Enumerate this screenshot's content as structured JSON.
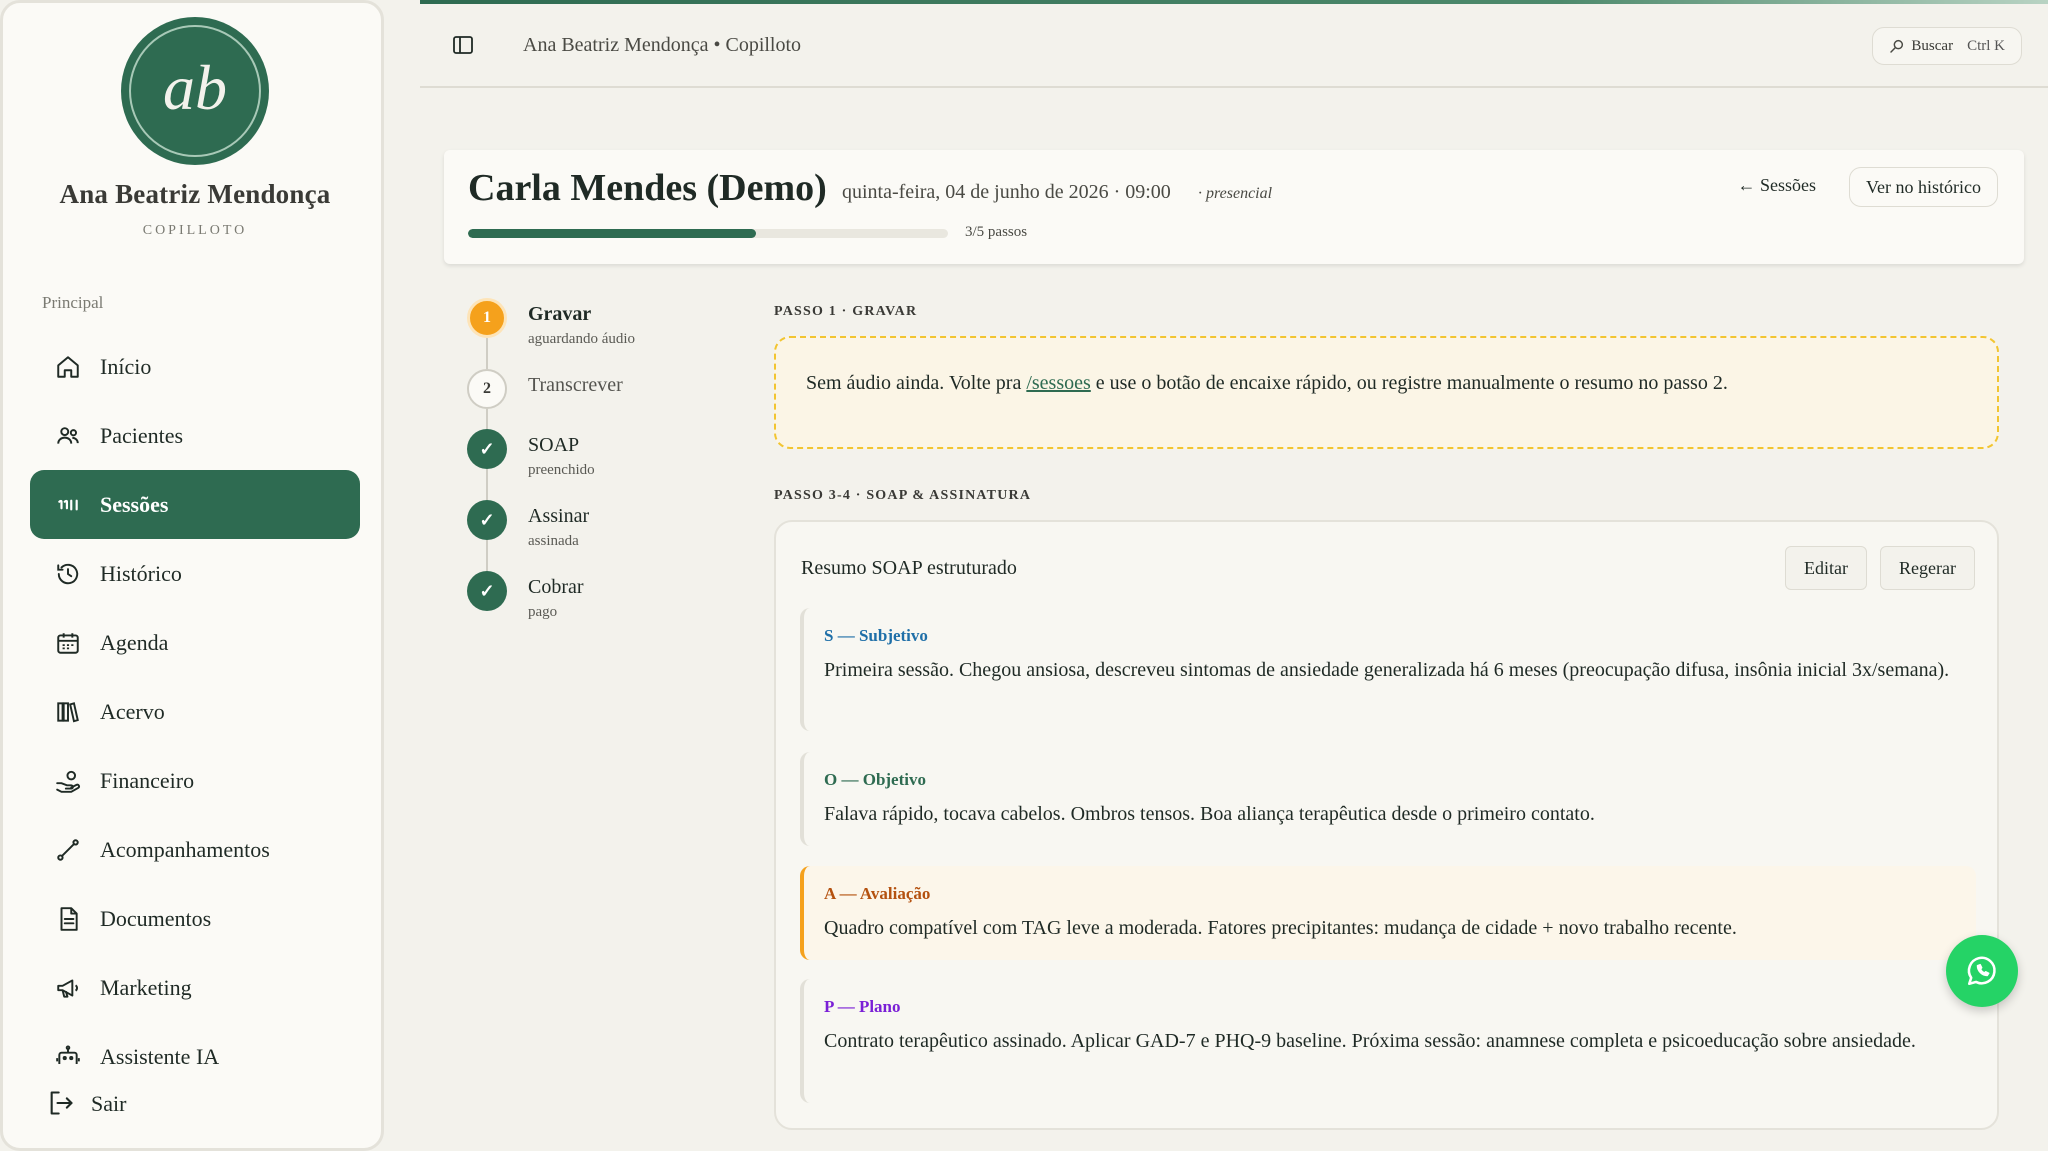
{
  "sidebar": {
    "avatar_initials": "ab",
    "brand_name": "Ana Beatriz Mendonça",
    "brand_sub": "COPILLOTO",
    "section_label": "Principal",
    "items": [
      {
        "label": "Início",
        "icon": "home-icon"
      },
      {
        "label": "Pacientes",
        "icon": "users-icon"
      },
      {
        "label": "Sessões",
        "icon": "sessions-icon",
        "active": true
      },
      {
        "label": "Histórico",
        "icon": "history-icon"
      },
      {
        "label": "Agenda",
        "icon": "calendar-icon"
      },
      {
        "label": "Acervo",
        "icon": "library-icon"
      },
      {
        "label": "Financeiro",
        "icon": "finance-icon"
      },
      {
        "label": "Acompanhamentos",
        "icon": "route-icon"
      },
      {
        "label": "Documentos",
        "icon": "document-icon"
      },
      {
        "label": "Marketing",
        "icon": "megaphone-icon"
      },
      {
        "label": "Assistente IA",
        "icon": "bot-icon"
      }
    ],
    "logout_label": "Sair"
  },
  "topbar": {
    "breadcrumb": "Ana Beatriz Mendonça • Copilloto",
    "search_label": "Buscar",
    "search_shortcut": "Ctrl K"
  },
  "session": {
    "patient_name": "Carla Mendes (Demo)",
    "date_time": "quinta-feira, 04 de junho de 2026 · 09:00",
    "mode": "· presencial",
    "progress_label": "3/5 passos",
    "progress_fraction": 0.6,
    "back_link": "← Sessões",
    "history_button": "Ver no histórico"
  },
  "steps": [
    {
      "number": "1",
      "title": "Gravar",
      "sub": "aguardando áudio",
      "state": "current"
    },
    {
      "number": "2",
      "title": "Transcrever",
      "sub": "",
      "state": "pending"
    },
    {
      "number": "✓",
      "title": "SOAP",
      "sub": "preenchido",
      "state": "done"
    },
    {
      "number": "✓",
      "title": "Assinar",
      "sub": "assinada",
      "state": "done"
    },
    {
      "number": "✓",
      "title": "Cobrar",
      "sub": "pago",
      "state": "done"
    }
  ],
  "step1": {
    "label": "PASSO 1 · GRAVAR",
    "text_before": "Sem áudio ainda. Volte pra ",
    "link": "/sessoes",
    "text_after": " e use o botão de encaixe rápido, ou registre manualmente o resumo no passo 2."
  },
  "soap": {
    "label": "PASSO 3-4 · SOAP & ASSINATURA",
    "title": "Resumo SOAP estruturado",
    "edit_button": "Editar",
    "regen_button": "Regerar",
    "sections": [
      {
        "head": "S — Subjetivo",
        "color": "#1f6fa8",
        "body": "Primeira sessão. Chegou ansiosa, descreveu sintomas de ansiedade generalizada há 6 meses (preocupação difusa, insônia inicial 3x/semana)."
      },
      {
        "head": "O — Objetivo",
        "color": "#2e6b51",
        "body": "Falava rápido, tocava cabelos. Ombros tensos. Boa aliança terapêutica desde o primeiro contato."
      },
      {
        "head": "A — Avaliação",
        "color": "#b4510f",
        "body": "Quadro compatível com TAG leve a moderada. Fatores precipitantes: mudança de cidade + novo trabalho recente."
      },
      {
        "head": "P — Plano",
        "color": "#7a1fd6",
        "body": "Contrato terapêutico assinado. Aplicar GAD-7 e PHQ-9 baseline. Próxima sessão: anamnese completa e psicoeducação sobre ansiedade."
      }
    ]
  },
  "colors": {
    "accent": "#2e6b51",
    "warning": "#f5a11c",
    "whatsapp": "#25d366"
  }
}
